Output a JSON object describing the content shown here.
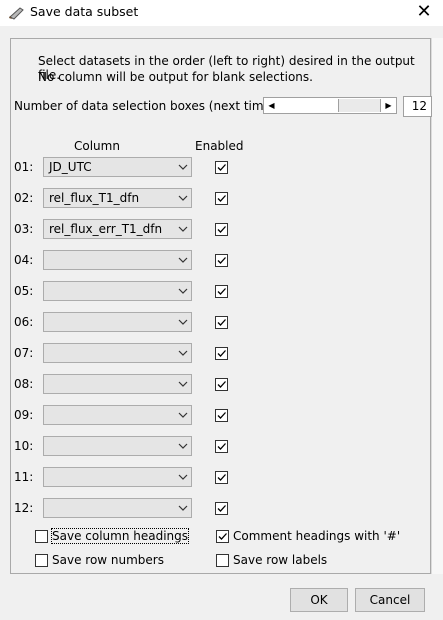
{
  "window": {
    "title": "Save data subset",
    "close_glyph": "✕",
    "icon": "app-brush-icon"
  },
  "instructions": {
    "line1": "Select datasets in the order (left to right) desired in the output file.",
    "line2": "No column will be output for blank selections."
  },
  "selection_boxes": {
    "label": "Number of data selection boxes (next time):",
    "value": "12"
  },
  "headers": {
    "column": "Column",
    "enabled": "Enabled"
  },
  "rows": [
    {
      "num": "01:",
      "value": "JD_UTC",
      "enabled": true
    },
    {
      "num": "02:",
      "value": "rel_flux_T1_dfn",
      "enabled": true
    },
    {
      "num": "03:",
      "value": "rel_flux_err_T1_dfn",
      "enabled": true
    },
    {
      "num": "04:",
      "value": "",
      "enabled": true
    },
    {
      "num": "05:",
      "value": "",
      "enabled": true
    },
    {
      "num": "06:",
      "value": "",
      "enabled": true
    },
    {
      "num": "07:",
      "value": "",
      "enabled": true
    },
    {
      "num": "08:",
      "value": "",
      "enabled": true
    },
    {
      "num": "09:",
      "value": "",
      "enabled": true
    },
    {
      "num": "10:",
      "value": "",
      "enabled": true
    },
    {
      "num": "11:",
      "value": "",
      "enabled": true
    },
    {
      "num": "12:",
      "value": "",
      "enabled": true
    }
  ],
  "options": {
    "save_column_headings": {
      "label": "Save column headings",
      "checked": false
    },
    "comment_headings": {
      "label": "Comment headings with '#'",
      "checked": true
    },
    "save_row_numbers": {
      "label": "Save row numbers",
      "checked": false
    },
    "save_row_labels": {
      "label": "Save row labels",
      "checked": false
    }
  },
  "buttons": {
    "ok": "OK",
    "cancel": "Cancel"
  }
}
